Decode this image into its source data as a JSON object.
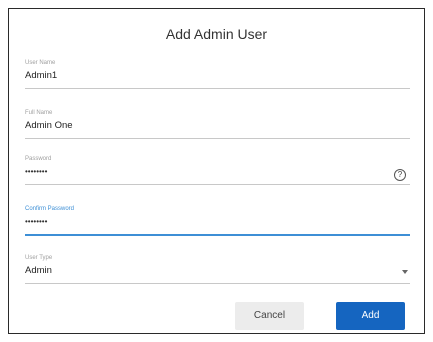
{
  "dialog": {
    "title": "Add Admin User"
  },
  "fields": {
    "username": {
      "label": "User Name",
      "value": "Admin1"
    },
    "fullname": {
      "label": "Full Name",
      "value": "Admin One"
    },
    "password": {
      "label": "Password",
      "value": "••••••••"
    },
    "confirm": {
      "label": "Confirm Password",
      "value": "••••••••"
    },
    "usertype": {
      "label": "User Type",
      "value": "Admin"
    }
  },
  "buttons": {
    "cancel": "Cancel",
    "add": "Add"
  },
  "colors": {
    "primary": "#1565c0",
    "focus": "#3d8fd6"
  },
  "icons": {
    "help": "help-circle-icon",
    "dropdown": "chevron-down-icon"
  }
}
